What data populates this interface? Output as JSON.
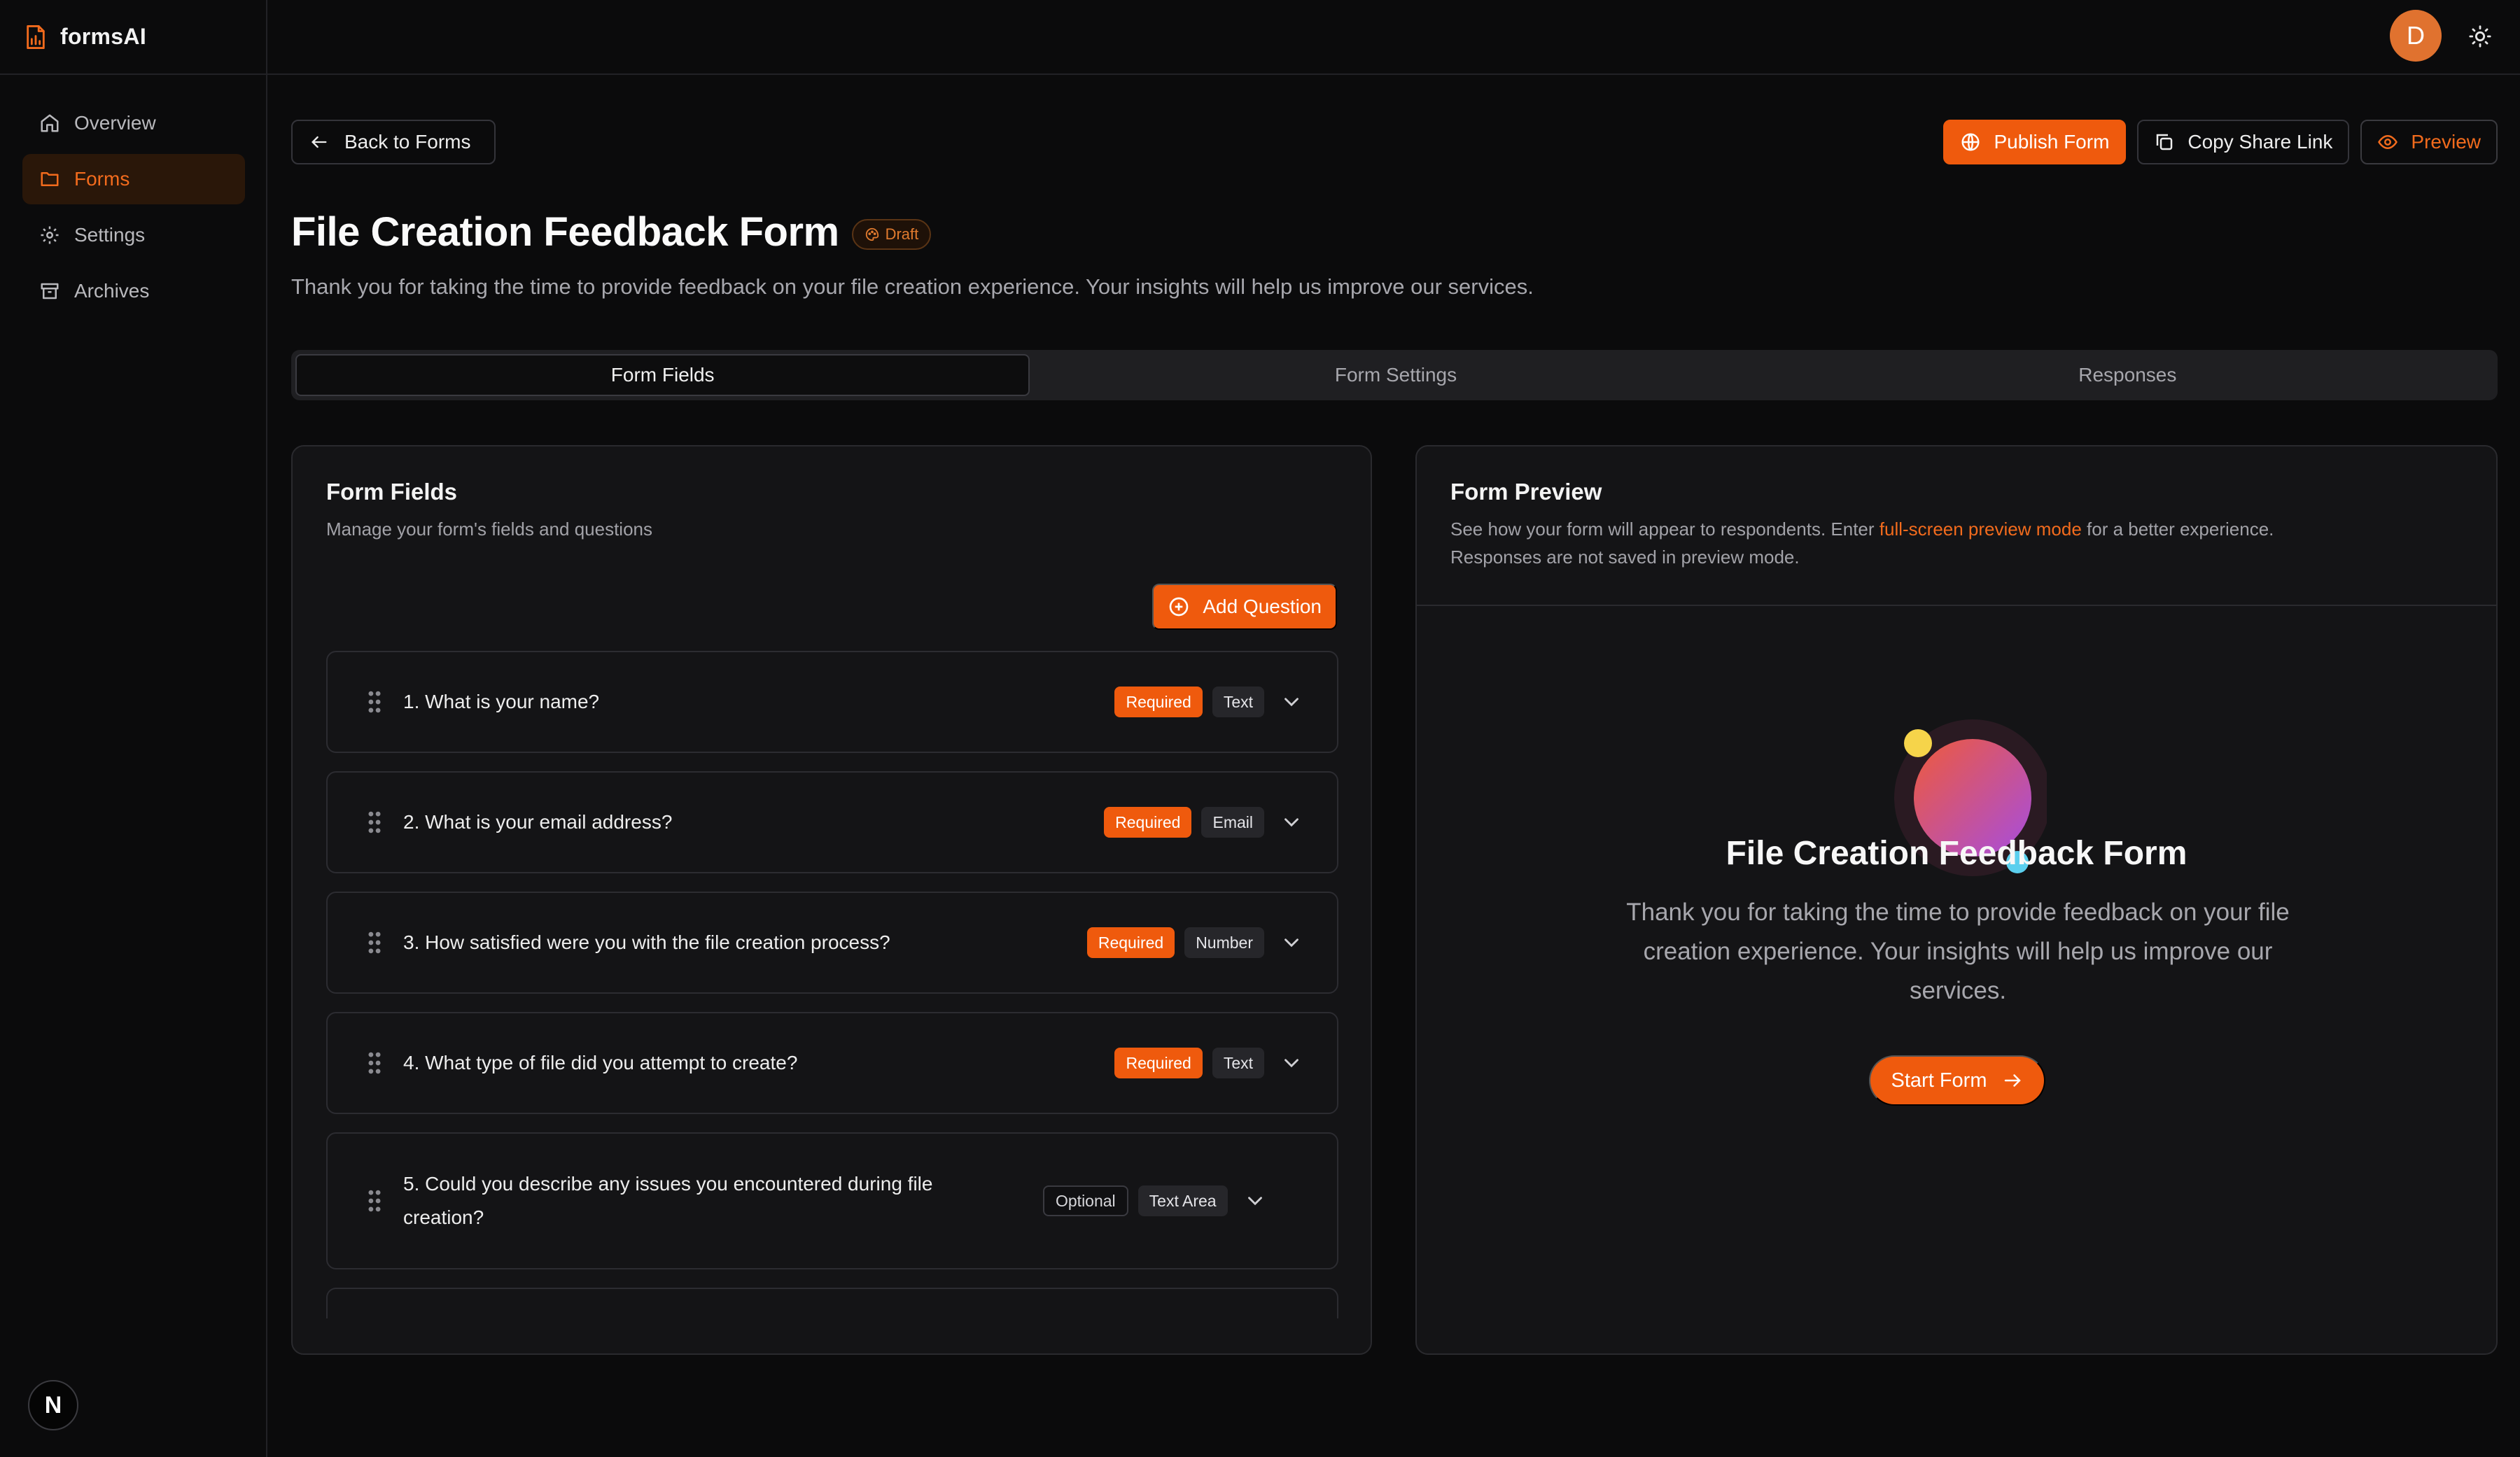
{
  "brand": {
    "name": "formsAI",
    "logo_icon": "file-chart-icon"
  },
  "sidebar": {
    "items": [
      {
        "label": "Overview",
        "icon": "home-icon",
        "active": false
      },
      {
        "label": "Forms",
        "icon": "folder-icon",
        "active": true
      },
      {
        "label": "Settings",
        "icon": "gear-icon",
        "active": false
      },
      {
        "label": "Archives",
        "icon": "archive-icon",
        "active": false
      }
    ],
    "footer_badge": "N"
  },
  "topbar": {
    "avatar_initial": "D",
    "theme_icon": "sun-icon"
  },
  "header": {
    "back_label": "Back to Forms",
    "publish_label": "Publish Form",
    "copy_label": "Copy Share Link",
    "preview_label": "Preview",
    "title": "File Creation Feedback Form",
    "status": "Draft",
    "description": "Thank you for taking the time to provide feedback on your file creation experience. Your insights will help us improve our services."
  },
  "tabs": [
    {
      "label": "Form Fields",
      "active": true
    },
    {
      "label": "Form Settings",
      "active": false
    },
    {
      "label": "Responses",
      "active": false
    }
  ],
  "fields_panel": {
    "title": "Form Fields",
    "subtitle": "Manage your form's fields and questions",
    "add_label": "Add Question",
    "questions": [
      {
        "text": "1. What is your name?",
        "required": "Required",
        "type": "Text"
      },
      {
        "text": "2. What is your email address?",
        "required": "Required",
        "type": "Email"
      },
      {
        "text": "3. How satisfied were you with the file creation process?",
        "required": "Required",
        "type": "Number"
      },
      {
        "text": "4. What type of file did you attempt to create?",
        "required": "Required",
        "type": "Text"
      },
      {
        "text": "5. Could you describe any issues you encountered during file creation?",
        "required": "Optional",
        "type": "Text Area"
      }
    ]
  },
  "preview_panel": {
    "title": "Form Preview",
    "sub_before": "See how your form will appear to respondents. Enter ",
    "sub_link": "full-screen preview mode",
    "sub_after": " for a better experience.",
    "sub_line2": "Responses are not saved in preview mode.",
    "form_title": "File Creation Feedback Form",
    "form_description": "Thank you for taking the time to provide feedback on your file creation experience. Your insights will help us improve our services.",
    "start_label": "Start Form"
  },
  "colors": {
    "accent": "#ef5a0d",
    "background": "#0b0b0c",
    "panel": "#141416"
  }
}
